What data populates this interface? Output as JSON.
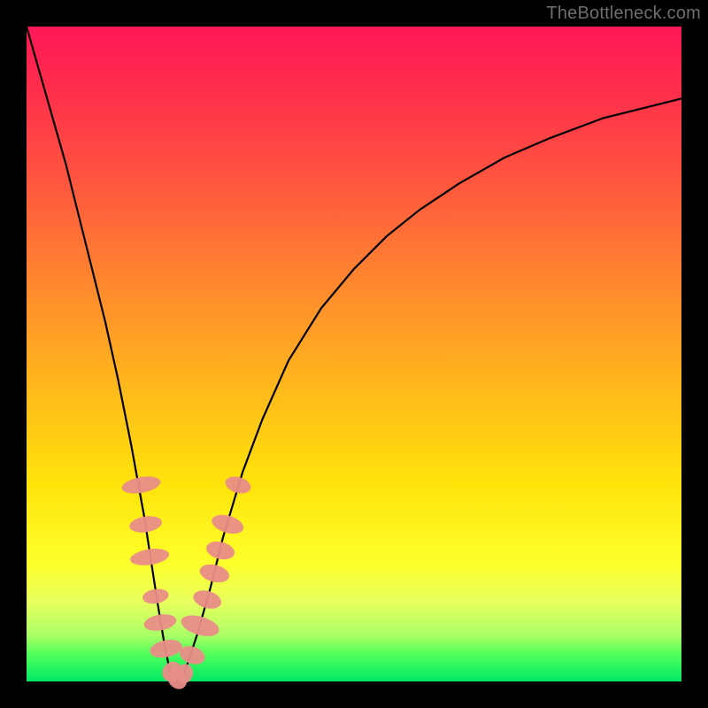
{
  "watermark": "TheBottleneck.com",
  "chart_data": {
    "type": "line",
    "title": "",
    "xlabel": "",
    "ylabel": "",
    "xlim": [
      0,
      100
    ],
    "ylim": [
      0,
      100
    ],
    "series": [
      {
        "name": "bottleneck-curve",
        "x": [
          0,
          2,
          4,
          6,
          8,
          10,
          12,
          14,
          16,
          18,
          20,
          21,
          22,
          23,
          24,
          26,
          28,
          30,
          33,
          36,
          40,
          45,
          50,
          55,
          60,
          66,
          73,
          80,
          88,
          96,
          100
        ],
        "y": [
          100,
          93,
          86,
          79,
          71,
          63,
          55,
          46,
          36,
          25,
          12,
          6,
          1,
          0,
          1,
          7,
          14,
          22,
          32,
          40,
          49,
          57,
          63,
          68,
          72,
          76,
          80,
          83,
          86,
          88,
          89
        ]
      }
    ],
    "markers": {
      "name": "highlighted-points",
      "color": "#e98d88",
      "points": [
        {
          "x": 17.5,
          "y": 30,
          "rx": 1.2,
          "ry": 3.0
        },
        {
          "x": 18.2,
          "y": 24,
          "rx": 1.2,
          "ry": 2.5
        },
        {
          "x": 18.8,
          "y": 19,
          "rx": 1.2,
          "ry": 3.0
        },
        {
          "x": 19.7,
          "y": 13,
          "rx": 1.1,
          "ry": 2.0
        },
        {
          "x": 20.4,
          "y": 9,
          "rx": 1.2,
          "ry": 2.5
        },
        {
          "x": 21.3,
          "y": 5,
          "rx": 1.3,
          "ry": 2.5
        },
        {
          "x": 22.2,
          "y": 1.5,
          "rx": 1.4,
          "ry": 1.6
        },
        {
          "x": 23.0,
          "y": 0.3,
          "rx": 1.6,
          "ry": 1.3
        },
        {
          "x": 24.1,
          "y": 1.2,
          "rx": 1.5,
          "ry": 1.3
        },
        {
          "x": 25.3,
          "y": 4.0,
          "rx": 1.3,
          "ry": 2.0
        },
        {
          "x": 26.5,
          "y": 8.5,
          "rx": 1.4,
          "ry": 3.0
        },
        {
          "x": 27.6,
          "y": 12.5,
          "rx": 1.3,
          "ry": 2.2
        },
        {
          "x": 28.7,
          "y": 16.5,
          "rx": 1.3,
          "ry": 2.3
        },
        {
          "x": 29.6,
          "y": 20.0,
          "rx": 1.3,
          "ry": 2.2
        },
        {
          "x": 30.7,
          "y": 24.0,
          "rx": 1.3,
          "ry": 2.5
        },
        {
          "x": 32.3,
          "y": 30.0,
          "rx": 1.2,
          "ry": 2.0
        }
      ]
    }
  }
}
